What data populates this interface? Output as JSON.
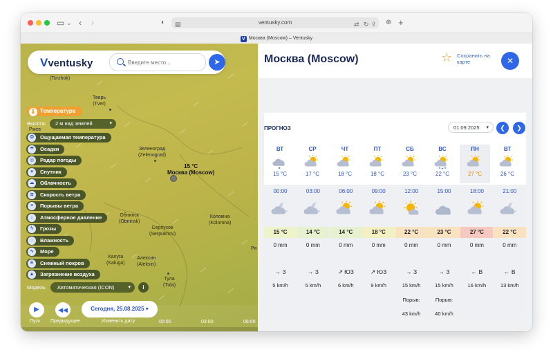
{
  "browser": {
    "url": "ventusky.com",
    "tab_title": "Москва (Moscow) – Ventusky",
    "favicon_letter": "V"
  },
  "map": {
    "logo": "ventusky",
    "search_placeholder": "Введите место...",
    "cities": [
      {
        "label": "(Torzhok)"
      },
      {
        "label": "Тверь\n(Tver)"
      },
      {
        "label": "Зеленоград\n(Zelenograd)"
      },
      {
        "label": "Обнинск\n(Obninsk)"
      },
      {
        "label": "Серпухов\n(Serpukhov)"
      },
      {
        "label": "Коломна\n(Kolomna)"
      },
      {
        "label": "Калуга\n(Kaluga)"
      },
      {
        "label": "Алексин\n(Aleksin)"
      },
      {
        "label": "Тула\n(Tula)"
      },
      {
        "label": "Ря"
      },
      {
        "label": "Ржев"
      }
    ],
    "moscow_label": {
      "temp": "15 °C",
      "name": "Москва (Moscow)"
    },
    "active_layer": "Температура",
    "height_label": "Высота:",
    "height_value": "2 м над землей",
    "layers": [
      "Ощущаемая температура",
      "Осадки",
      "Радар погоды",
      "Спутник",
      "Облачность",
      "Скорость ветра",
      "Порывы ветра",
      "Атмосферное давление",
      "Грозы",
      "Влажность",
      "Море",
      "Снежный покров",
      "Загрязнение воздуха"
    ],
    "model_label": "Модель",
    "model_value": "Автоматическая (ICON)",
    "play_label": "Пуск",
    "prev_label": "Предыдущее",
    "date_button": "Сегодня, 25.08.2025",
    "change_date_label": "Изменить дату",
    "timeline": [
      "00:00",
      "03:00",
      "06:00"
    ]
  },
  "panel": {
    "title": "Москва (Moscow)",
    "save_label": "Сохранить на карте",
    "section_title": "ПРОГНОЗ",
    "date_value": "01.09.2025",
    "days": [
      {
        "name": "ВТ",
        "temp": "15 °C",
        "icon": "cloud-rain-icon"
      },
      {
        "name": "СР",
        "temp": "17 °C",
        "icon": "partly-cloudy-icon"
      },
      {
        "name": "ЧТ",
        "temp": "18 °C",
        "icon": "partly-cloudy-icon"
      },
      {
        "name": "ПТ",
        "temp": "18 °C",
        "icon": "partly-cloudy-icon"
      },
      {
        "name": "СБ",
        "temp": "23 °C",
        "icon": "partly-cloudy-icon"
      },
      {
        "name": "ВС",
        "temp": "22 °C",
        "icon": "sun-rain-icon"
      },
      {
        "name": "ПН",
        "temp": "27 °C",
        "icon": "partly-cloudy-icon",
        "selected": true
      },
      {
        "name": "ВТ",
        "temp": "26 °C",
        "icon": "partly-cloudy-icon"
      }
    ],
    "hours": [
      {
        "time": "00:00",
        "icon": "moon-cloud-icon",
        "temp": "15 °C",
        "precip": "0 mm",
        "wind": "→ З",
        "speed": "5 km/h",
        "gust_label": "",
        "gust": "",
        "color": "#eef3c9"
      },
      {
        "time": "03:00",
        "icon": "moon-cloud-icon",
        "temp": "14 °C",
        "precip": "0 mm",
        "wind": "→ З",
        "speed": "5 km/h",
        "gust_label": "",
        "gust": "",
        "color": "#e7f1cf"
      },
      {
        "time": "06:00",
        "icon": "partly-cloudy-icon",
        "temp": "14 °C",
        "precip": "0 mm",
        "wind": "↗ ЮЗ",
        "speed": "6 km/h",
        "gust_label": "",
        "gust": "",
        "color": "#e7f1cf"
      },
      {
        "time": "09:00",
        "icon": "partly-cloudy-icon",
        "temp": "18 °C",
        "precip": "0 mm",
        "wind": "↗ ЮЗ",
        "speed": "9 km/h",
        "gust_label": "",
        "gust": "",
        "color": "#f3f0c4"
      },
      {
        "time": "12:00",
        "icon": "sun-cloud-icon",
        "temp": "22 °C",
        "precip": "0 mm",
        "wind": "→ З",
        "speed": "15 km/h",
        "gust_label": "Порыв:",
        "gust": "43 km/h",
        "color": "#f8e2c0"
      },
      {
        "time": "15:00",
        "icon": "cloud-icon",
        "temp": "23 °C",
        "precip": "0 mm",
        "wind": "→ З",
        "speed": "15 km/h",
        "gust_label": "Порыв:",
        "gust": "40 km/h",
        "color": "#f8e2c0"
      },
      {
        "time": "18:00",
        "icon": "partly-cloudy-icon",
        "temp": "27 °C",
        "precip": "0 mm",
        "wind": "← В",
        "speed": "16 km/h",
        "gust_label": "",
        "gust": "",
        "color": "#f5c9c0"
      },
      {
        "time": "21:00",
        "icon": "moon-cloud-icon",
        "temp": "22 °C",
        "precip": "0 mm",
        "wind": "← В",
        "speed": "13 km/h",
        "gust_label": "",
        "gust": "",
        "color": "#f8e2c0"
      }
    ],
    "colors": {
      "accent": "#2e67e8",
      "title": "#1c2a57",
      "star": "#f0a030"
    }
  }
}
